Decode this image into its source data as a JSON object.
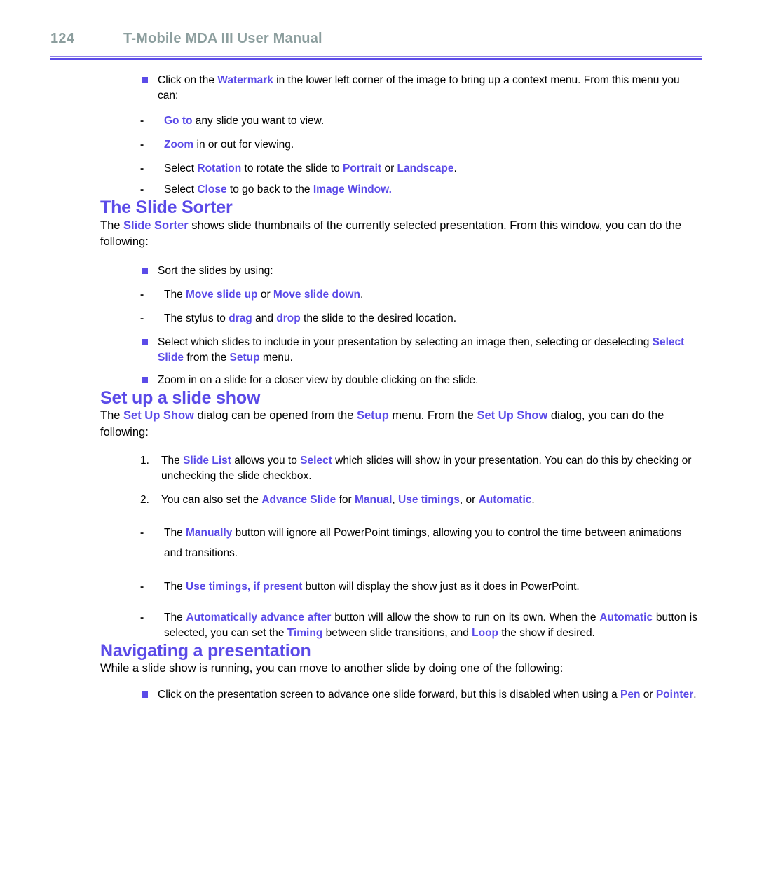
{
  "header": {
    "page_number": "124",
    "title": "T-Mobile MDA III User Manual"
  },
  "colors": {
    "accent": "#5b4be8",
    "header_text": "#8c9e9e",
    "body_text": "#000000",
    "rule_thin": "#8b7ee8",
    "rule_thick": "#5b4be8"
  },
  "intro_bullet": {
    "part1": "Click on the ",
    "term1": "Watermark",
    "part2": " in the lower left corner of the image to bring up a context menu. From this menu you can:"
  },
  "intro_subitems": [
    {
      "marker": "-",
      "term1": "Go to",
      "rest": " any slide you want to view."
    },
    {
      "marker": "-",
      "term1": "Zoom",
      "rest": " in or out for viewing."
    },
    {
      "marker": "-",
      "pre": "Select ",
      "term1": "Rotation",
      "mid": " to rotate the slide to ",
      "term2": "Portrait",
      "mid2": " or ",
      "term3": "Landscape",
      "rest": "."
    },
    {
      "marker": "-",
      "pre": "Select ",
      "term1": "Close",
      "mid": " to go back to the ",
      "term2": "Image Window.",
      "rest": ""
    }
  ],
  "slide_sorter": {
    "heading": "The Slide Sorter",
    "intro_pre": "The ",
    "intro_term": "Slide Sorter",
    "intro_post": " shows slide thumbnails of the currently selected presentation. From this window, you can do the following:",
    "bullets": [
      {
        "text": "Sort the slides by using:"
      }
    ],
    "sub_bullets": [
      {
        "marker": "-",
        "pre": "The ",
        "term1": "Move slide up",
        "mid": " or ",
        "term2": "Move slide down",
        "rest": "."
      },
      {
        "marker": "-",
        "pre": "The stylus to ",
        "term1": "drag",
        "mid": " and ",
        "term2": "drop",
        "rest": " the slide to the desired location."
      }
    ],
    "bullet_select": {
      "pre": "Select which slides to include in your presentation by selecting an image then, selecting or deselecting ",
      "term1": "Select Slide",
      "mid": " from the ",
      "term2": "Setup",
      "rest": " menu."
    },
    "bullet_zoom": {
      "text": "Zoom in on a slide for a closer view by double clicking on the slide."
    }
  },
  "slide_show": {
    "heading": "Set up a slide show",
    "intro_pre": "The ",
    "intro_term1": "Set Up Show",
    "intro_mid": " dialog can be opened from the ",
    "intro_term2": "Setup",
    "intro_mid2": " menu. From the ",
    "intro_term3": "Set Up Show",
    "intro_post": " dialog, you can do the following:",
    "numbered": [
      {
        "marker": "1.",
        "pre": "The ",
        "term1": "Slide List",
        "mid": " allows you to ",
        "term2": "Select",
        "rest": " which slides will show in your presentation. You can do this by checking or unchecking the slide checkbox."
      },
      {
        "marker": "2.",
        "pre": "You can also set the ",
        "term1": "Advance Slide",
        "mid": " for ",
        "term2": "Manual",
        "mid2": ", ",
        "term3": "Use timings",
        "mid3": ", or ",
        "term4": "Automatic",
        "rest": "."
      }
    ],
    "dashes": [
      {
        "marker": "-",
        "pre": "The ",
        "term1": "Manually",
        "rest": " button will ignore all PowerPoint timings, allowing you to control the time between animations and transitions."
      },
      {
        "marker": "-",
        "pre": "The ",
        "term1": "Use timings, if present",
        "rest": " button will display the show just as it does in PowerPoint."
      },
      {
        "marker": "-",
        "pre": "The ",
        "term1": "Automatically advance after",
        "mid": " button will allow the show to run on its own. When the ",
        "term2": "Automatic",
        "mid2": " button is selected, you can set the ",
        "term3": "Timing",
        "mid3": " between slide transitions, and ",
        "term4": "Loop",
        "rest": " the show if desired."
      }
    ]
  },
  "navigating": {
    "heading": "Navigating a presentation",
    "intro": "While a slide show is running, you can move to another slide by doing one of the following:",
    "bullet": {
      "pre": "Click on the presentation screen to advance one slide forward, but this is disabled when using a ",
      "term1": "Pen",
      "mid": " or ",
      "term2": "Pointer",
      "rest": "."
    }
  }
}
